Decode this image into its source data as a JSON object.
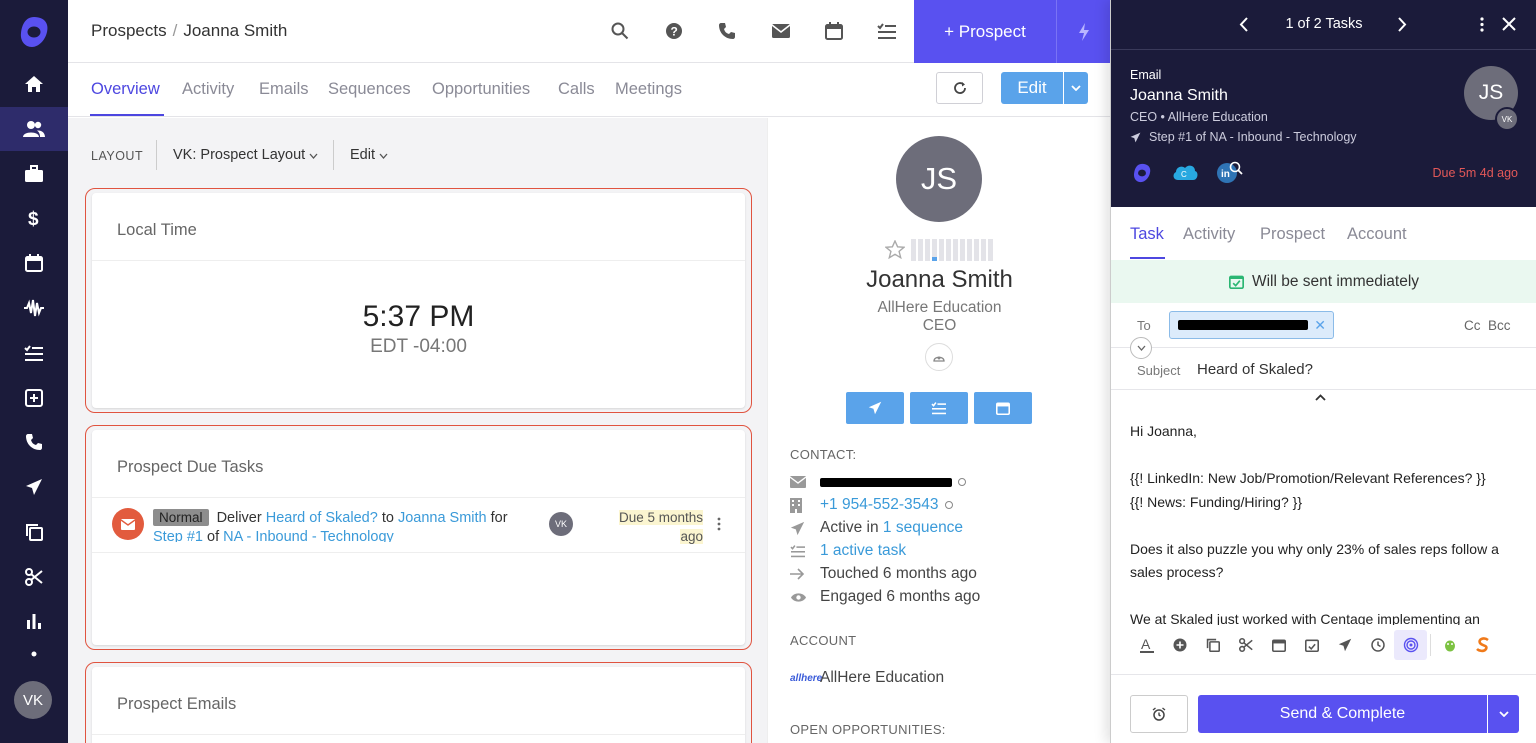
{
  "nav": {
    "items": [
      "home",
      "prospects",
      "accounts",
      "opportunities",
      "meetings",
      "calls",
      "tasks",
      "snippets",
      "phone",
      "sequences",
      "templates",
      "plays",
      "reports",
      "more"
    ],
    "avatar_initials": "VK"
  },
  "header": {
    "breadcrumb_parent": "Prospects",
    "breadcrumb_current": "Joanna Smith",
    "add_prospect_label": "+ Prospect"
  },
  "tabs": {
    "items": [
      "Overview",
      "Activity",
      "Emails",
      "Sequences",
      "Opportunities",
      "Calls",
      "Meetings"
    ],
    "active": "Overview",
    "edit_label": "Edit"
  },
  "layout": {
    "label": "LAYOUT",
    "selected": "VK: Prospect Layout",
    "edit_label": "Edit"
  },
  "local_time": {
    "title": "Local Time",
    "time": "5:37 PM",
    "tz": "EDT -04:00"
  },
  "due_tasks": {
    "title": "Prospect Due Tasks",
    "row": {
      "priority": "Normal",
      "t1": "Deliver",
      "template": "Heard of Skaled?",
      "t2": "to",
      "prospect": "Joanna Smith",
      "t3": "for",
      "step": "Step #1",
      "t4": "of",
      "sequence": "NA - Inbound - Technology",
      "owner": "VK",
      "due": "Due 5 months ago"
    }
  },
  "emails_card": {
    "title": "Prospect Emails"
  },
  "profile": {
    "initials": "JS",
    "name": "Joanna Smith",
    "company": "AllHere Education",
    "title": "CEO",
    "contact_label": "CONTACT:",
    "phone": "+1 954-552-3543",
    "active_in_prefix": "Active in",
    "active_in_link": "1 sequence",
    "active_task": "1 active task",
    "touched": "Touched 6 months ago",
    "engaged": "Engaged 6 months ago",
    "account_label": "ACCOUNT",
    "account_logo": "allhere",
    "account_name": "AllHere Education",
    "opps_label": "OPEN OPPORTUNITIES:"
  },
  "panel": {
    "task_count": "1 of 2 Tasks",
    "task_type": "Email",
    "name": "Joanna Smith",
    "subtitle": "CEO • AllHere Education",
    "step": "Step #1 of NA - Inbound - Technology",
    "initials": "JS",
    "owner_initials": "VK",
    "due": "Due 5m 4d ago",
    "tabs": [
      "Task",
      "Activity",
      "Prospect",
      "Account"
    ],
    "banner": "Will be sent immediately",
    "to_label": "To",
    "cc_label": "Cc",
    "bcc_label": "Bcc",
    "subject_label": "Subject",
    "subject": "Heard of Skaled?",
    "body": [
      "Hi Joanna,",
      "",
      "{{! LinkedIn: New Job/Promotion/Relevant References? }}",
      "{{! News: Funding/Hiring? }}",
      "",
      "Does it also puzzle you why only 23% of sales reps follow a sales process?",
      "",
      "We at Skaled just worked with Centage implementing an"
    ],
    "send_label": "Send & Complete"
  },
  "colors": {
    "brand": "#5951f0",
    "nav_bg": "#1b1b3a",
    "link": "#3a9ad9",
    "outline": "#e0533f",
    "due": "#e35858"
  }
}
